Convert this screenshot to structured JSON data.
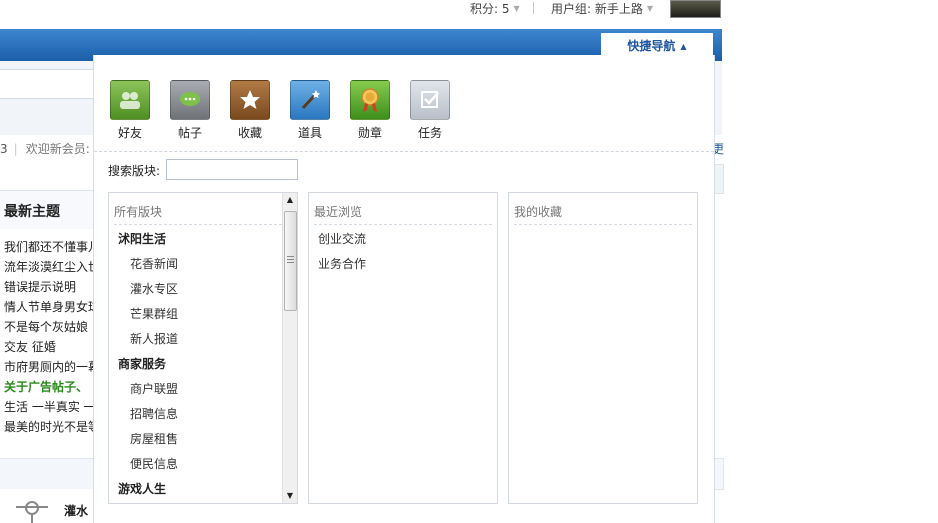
{
  "topbar": {
    "score": "积分: 5",
    "user_group": "用户组: 新手上路"
  },
  "quick_nav": {
    "title": "快捷导航",
    "tools": [
      {
        "label": "好友",
        "icon": "friends-icon",
        "color": "#6aa53a"
      },
      {
        "label": "帖子",
        "icon": "post-icon",
        "color": "#8a8e93"
      },
      {
        "label": "收藏",
        "icon": "favorite-icon",
        "color": "#8b5a2b"
      },
      {
        "label": "道具",
        "icon": "magic-wand-icon",
        "color": "#3b8ed0"
      },
      {
        "label": "勋章",
        "icon": "medal-icon",
        "color": "#5cae2c"
      },
      {
        "label": "任务",
        "icon": "task-icon",
        "color": "#c9ced6"
      }
    ],
    "search_label": "搜索版块:",
    "search_value": "",
    "columns": {
      "all_forums": {
        "header": "所有版块",
        "items": [
          {
            "label": "沭阳生活",
            "type": "cat"
          },
          {
            "label": "花香新闻",
            "type": "sub"
          },
          {
            "label": "灌水专区",
            "type": "sub"
          },
          {
            "label": "芒果群组",
            "type": "sub"
          },
          {
            "label": "新人报道",
            "type": "sub"
          },
          {
            "label": "商家服务",
            "type": "cat"
          },
          {
            "label": "商户联盟",
            "type": "sub"
          },
          {
            "label": "招聘信息",
            "type": "sub"
          },
          {
            "label": "房屋租售",
            "type": "sub"
          },
          {
            "label": "便民信息",
            "type": "sub"
          },
          {
            "label": "游戏人生",
            "type": "cat"
          }
        ]
      },
      "recent": {
        "header": "最近浏览",
        "items": [
          "创业交流",
          "业务合作"
        ]
      },
      "favorites": {
        "header": "我的收藏",
        "items": []
      }
    }
  },
  "background": {
    "welcome_prefix": "3",
    "welcome_label": "欢迎新会员: 爱",
    "right_link": "更",
    "latest_heading": "最新主题",
    "threads": [
      {
        "text": "我们都还不懂事儿",
        "green": false
      },
      {
        "text": "流年淡漠红尘入世",
        "green": false
      },
      {
        "text": "错误提示说明",
        "green": false
      },
      {
        "text": "情人节单身男女球",
        "green": false
      },
      {
        "text": "不是每个灰姑娘",
        "green": false
      },
      {
        "text": "交友 征婚",
        "green": false
      },
      {
        "text": "市府男厕内的一幕",
        "green": false
      },
      {
        "text": "关于广告帖子、",
        "green": true
      },
      {
        "text": "生活 一半真实 一",
        "green": false
      },
      {
        "text": "最美的时光不是等",
        "green": false
      }
    ],
    "bottom_text": "灌水"
  }
}
